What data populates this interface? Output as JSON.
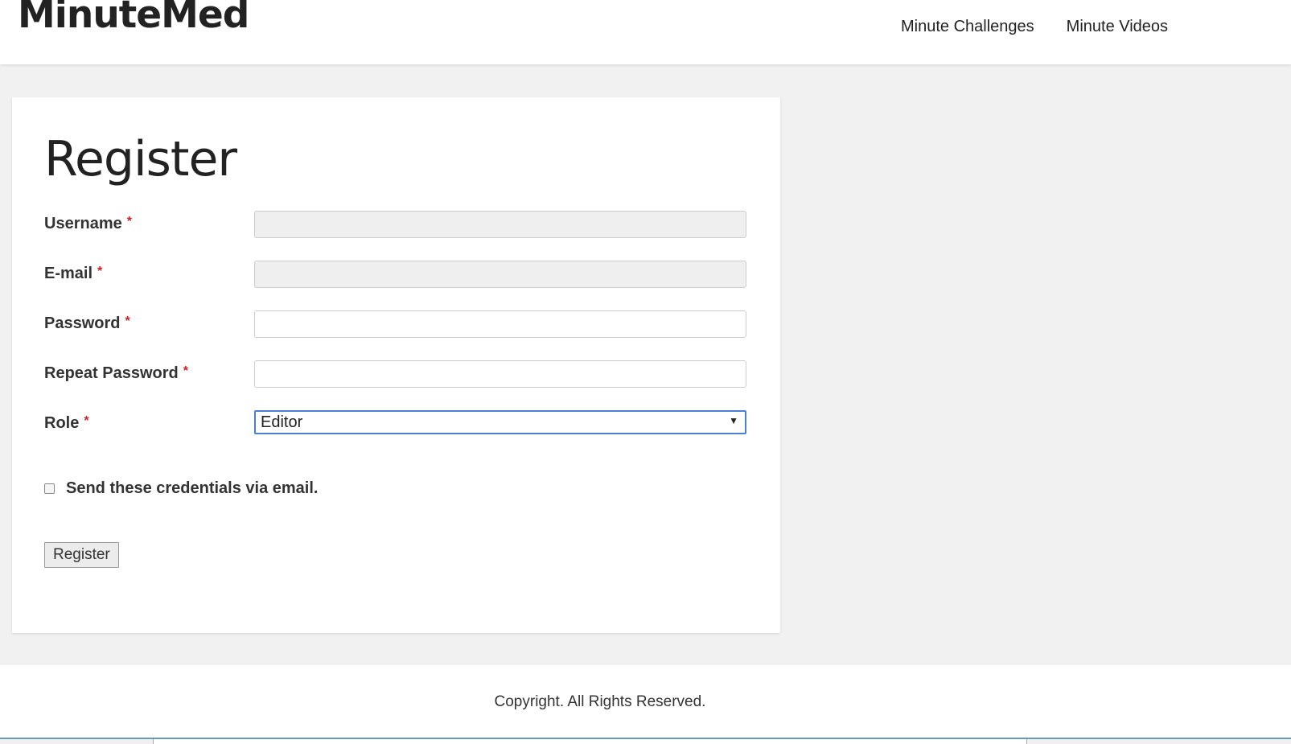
{
  "header": {
    "logo": "MinuteMed",
    "nav": [
      {
        "label": "Minute Challenges"
      },
      {
        "label": "Minute Videos"
      }
    ]
  },
  "form": {
    "title": "Register",
    "fields": {
      "username": {
        "label": "Username",
        "required": "*",
        "value": ""
      },
      "email": {
        "label": "E-mail",
        "required": "*",
        "value": ""
      },
      "password": {
        "label": "Password",
        "required": "*",
        "value": ""
      },
      "repeat_password": {
        "label": "Repeat Password",
        "required": "*",
        "value": ""
      },
      "role": {
        "label": "Role",
        "required": "*",
        "value": "Editor"
      }
    },
    "checkbox": {
      "label": "Send these credentials via email.",
      "checked": false
    },
    "submit_label": "Register"
  },
  "footer": {
    "text": "Copyright. All Rights Reserved."
  },
  "colors": {
    "page_bg": "#f2f1f1",
    "required": "#cc2222",
    "select_focus": "#4a7fd4"
  }
}
